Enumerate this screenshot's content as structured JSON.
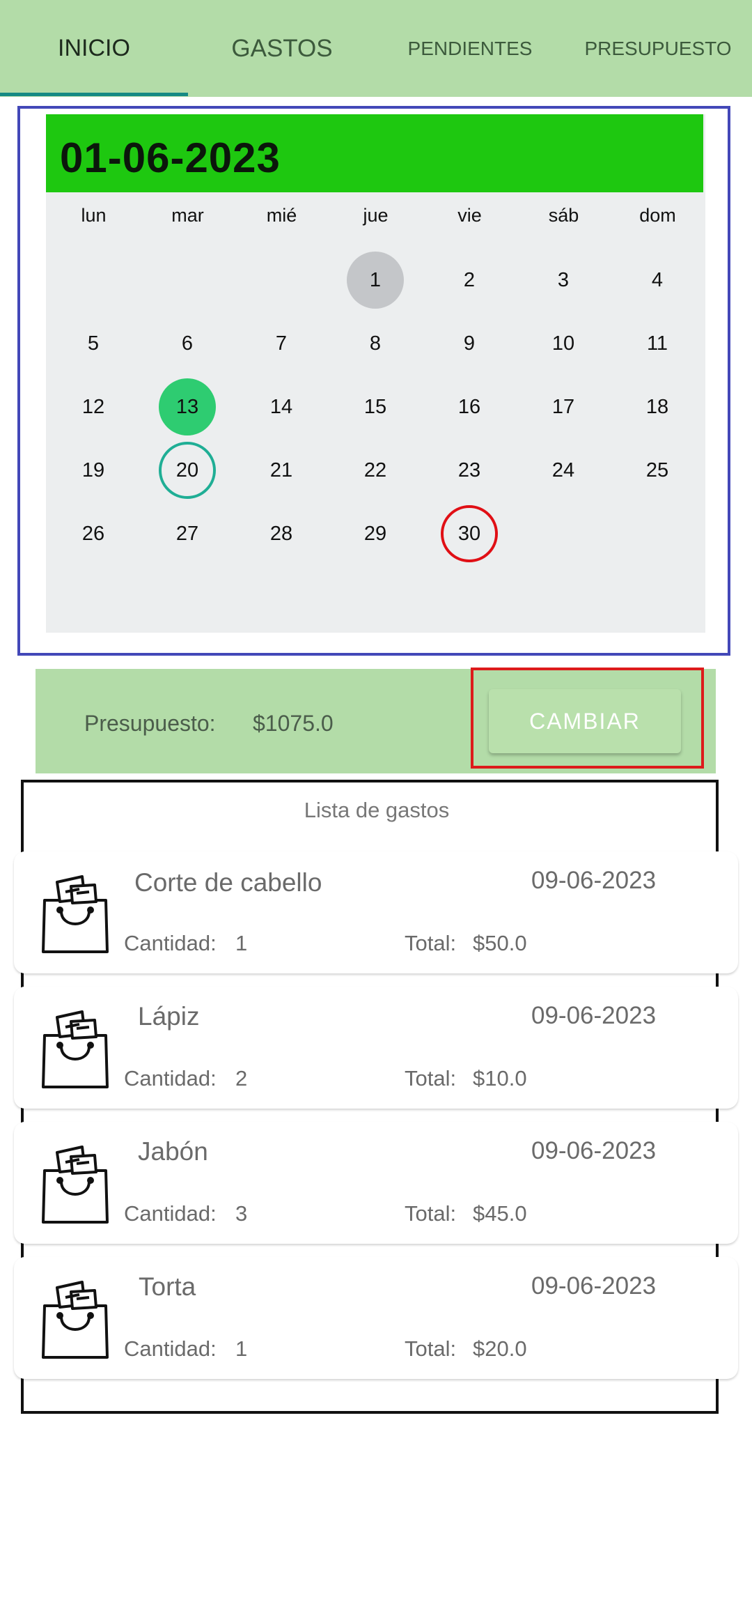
{
  "tabs": [
    {
      "label": "INICIO",
      "active": true
    },
    {
      "label": "GASTOS"
    },
    {
      "label": "PENDIENTES"
    },
    {
      "label": "PRESUPUESTO"
    }
  ],
  "calendar": {
    "header_date": "01-06-2023",
    "weekdays": [
      "lun",
      "mar",
      "mié",
      "jue",
      "vie",
      "sáb",
      "dom"
    ],
    "weeks": [
      [
        "",
        "",
        "",
        "1",
        "2",
        "3",
        "4"
      ],
      [
        "5",
        "6",
        "7",
        "8",
        "9",
        "10",
        "11"
      ],
      [
        "12",
        "13",
        "14",
        "15",
        "16",
        "17",
        "18"
      ],
      [
        "19",
        "20",
        "21",
        "22",
        "23",
        "24",
        "25"
      ],
      [
        "26",
        "27",
        "28",
        "29",
        "30",
        "",
        ""
      ]
    ],
    "today_day": "1",
    "selected_day": "13",
    "teal_outlined_day": "20",
    "red_outlined_day": "30",
    "colors": {
      "header": "#1ec810",
      "selected": "#2ecc71",
      "today": "#c4c6c9",
      "teal": "#1fae95",
      "red": "#e00f15"
    }
  },
  "budget": {
    "label": "Presupuesto:",
    "value": "$1075.0",
    "change_button": "CAMBIAR"
  },
  "expenses": {
    "title": "Lista de gastos",
    "quantity_label": "Cantidad:",
    "total_label": "Total:",
    "icon": "shopping-bag-icon",
    "items": [
      {
        "name": "Corte de cabello",
        "date": "09-06-2023",
        "quantity": "1",
        "total": "$50.0"
      },
      {
        "name": "Lápiz",
        "date": "09-06-2023",
        "quantity": "2",
        "total": "$10.0"
      },
      {
        "name": "Jabón",
        "date": "09-06-2023",
        "quantity": "3",
        "total": "$45.0"
      },
      {
        "name": "Torta",
        "date": "09-06-2023",
        "quantity": "1",
        "total": "$20.0"
      }
    ]
  },
  "colors": {
    "tab_background": "#b3dca8",
    "tab_indicator": "#168a84"
  }
}
